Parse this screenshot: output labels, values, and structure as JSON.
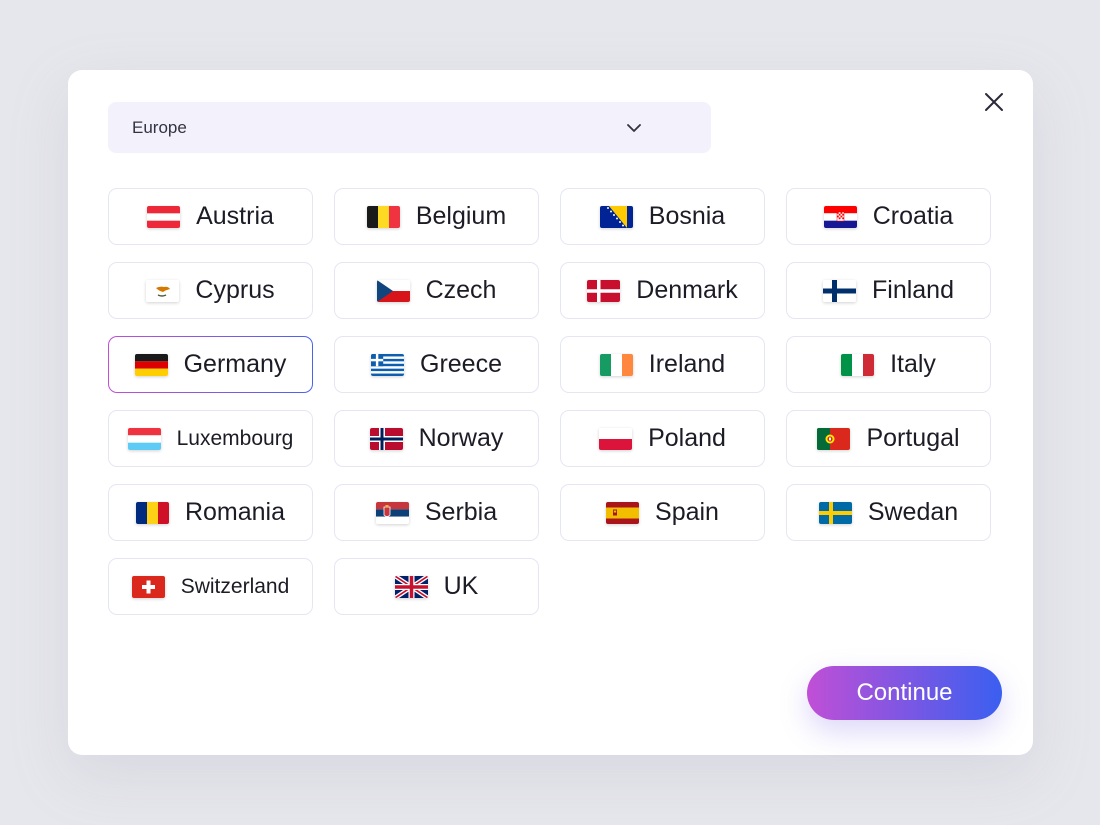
{
  "region_select": {
    "value": "Europe"
  },
  "countries": [
    {
      "name": "Austria",
      "flag": "austria-flag-icon"
    },
    {
      "name": "Belgium",
      "flag": "belgium-flag-icon"
    },
    {
      "name": "Bosnia",
      "flag": "bosnia-flag-icon"
    },
    {
      "name": "Croatia",
      "flag": "croatia-flag-icon"
    },
    {
      "name": "Cyprus",
      "flag": "cyprus-flag-icon"
    },
    {
      "name": "Czech",
      "flag": "czech-flag-icon"
    },
    {
      "name": "Denmark",
      "flag": "denmark-flag-icon"
    },
    {
      "name": "Finland",
      "flag": "finland-flag-icon"
    },
    {
      "name": "Germany",
      "flag": "germany-flag-icon",
      "selected": true
    },
    {
      "name": "Greece",
      "flag": "greece-flag-icon"
    },
    {
      "name": "Ireland",
      "flag": "ireland-flag-icon"
    },
    {
      "name": "Italy",
      "flag": "italy-flag-icon"
    },
    {
      "name": "Luxembourg",
      "flag": "luxembourg-flag-icon"
    },
    {
      "name": "Norway",
      "flag": "norway-flag-icon"
    },
    {
      "name": "Poland",
      "flag": "poland-flag-icon"
    },
    {
      "name": "Portugal",
      "flag": "portugal-flag-icon"
    },
    {
      "name": "Romania",
      "flag": "romania-flag-icon"
    },
    {
      "name": "Serbia",
      "flag": "serbia-flag-icon"
    },
    {
      "name": "Spain",
      "flag": "spain-flag-icon"
    },
    {
      "name": "Swedan",
      "flag": "sweden-flag-icon"
    },
    {
      "name": "Switzerland",
      "flag": "switzerland-flag-icon"
    },
    {
      "name": "UK",
      "flag": "uk-flag-icon"
    }
  ],
  "continue_button": {
    "label": "Continue"
  },
  "colors": {
    "accent_start": "#c04fd6",
    "accent_end": "#3a5ff0",
    "select_bg": "#f3f2fc",
    "card_border": "#e6e6f3"
  }
}
